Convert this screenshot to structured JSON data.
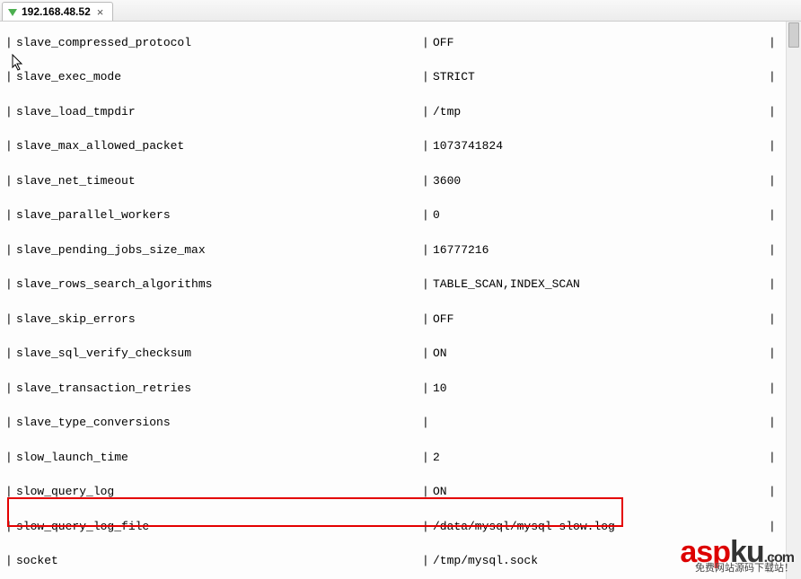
{
  "tab": {
    "title": "192.168.48.52",
    "close_glyph": "×"
  },
  "rows": [
    {
      "key": "slave_compressed_protocol",
      "value": "OFF"
    },
    {
      "key": "slave_exec_mode",
      "value": "STRICT"
    },
    {
      "key": "slave_load_tmpdir",
      "value": "/tmp"
    },
    {
      "key": "slave_max_allowed_packet",
      "value": "1073741824"
    },
    {
      "key": "slave_net_timeout",
      "value": "3600"
    },
    {
      "key": "slave_parallel_workers",
      "value": "0"
    },
    {
      "key": "slave_pending_jobs_size_max",
      "value": "16777216"
    },
    {
      "key": "slave_rows_search_algorithms",
      "value": "TABLE_SCAN,INDEX_SCAN"
    },
    {
      "key": "slave_skip_errors",
      "value": "OFF"
    },
    {
      "key": "slave_sql_verify_checksum",
      "value": "ON"
    },
    {
      "key": "slave_transaction_retries",
      "value": "10"
    },
    {
      "key": "slave_type_conversions",
      "value": ""
    },
    {
      "key": "slow_launch_time",
      "value": "2"
    },
    {
      "key": "slow_query_log",
      "value": "ON"
    },
    {
      "key": "slow_query_log_file",
      "value": "/data/mysql/mysql-slow.log",
      "highlight": true
    },
    {
      "key": "socket",
      "value": "/tmp/mysql.sock"
    }
  ],
  "watermark": {
    "brand_left": "asp",
    "brand_right": "ku",
    "suffix": ".com",
    "sub": "免费网站源码下载站！"
  }
}
